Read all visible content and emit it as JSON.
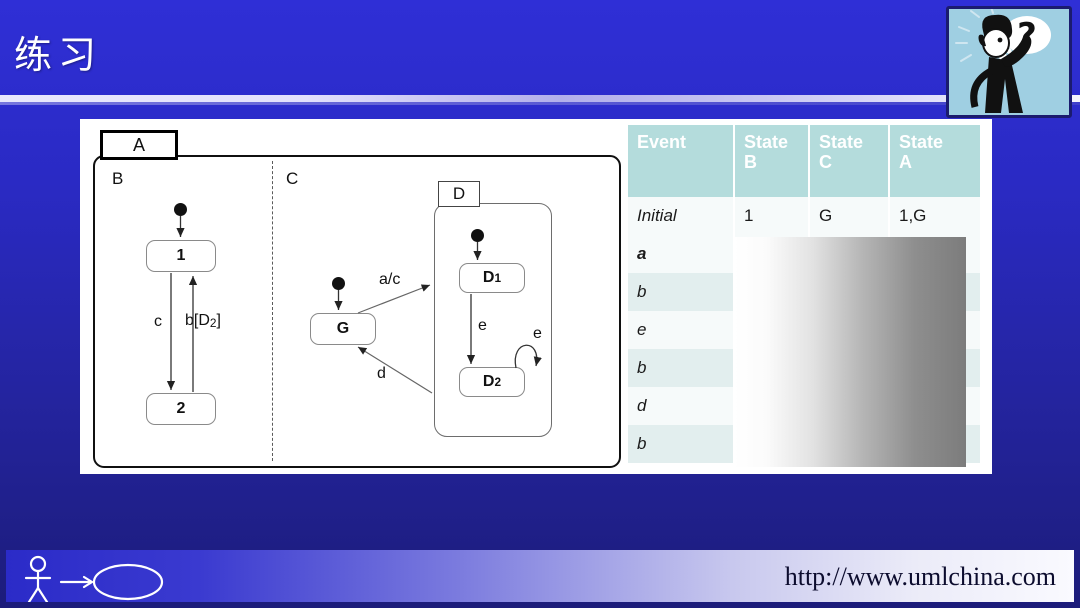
{
  "slide": {
    "title": "练习",
    "background_top": "#2f2fd6",
    "background_bottom": "#1c1c7a"
  },
  "decoration": {
    "thinker_icon": "thinking-person-icon",
    "question_mark": "?"
  },
  "diagram": {
    "outer_state_name": "A",
    "regions": [
      {
        "label": "B"
      },
      {
        "label": "C"
      }
    ],
    "states": [
      {
        "id": "s1",
        "label": "1"
      },
      {
        "id": "s2",
        "label": "2"
      },
      {
        "id": "sG",
        "label": "G"
      },
      {
        "id": "sD1",
        "label": "D",
        "sub": "1"
      },
      {
        "id": "sD2",
        "label": "D",
        "sub": "2"
      }
    ],
    "composite_state_name": "D",
    "transitions": [
      {
        "from": "1",
        "to": "2",
        "label": "c"
      },
      {
        "from": "2",
        "to": "1",
        "label": "b[D2]",
        "label_main": "b[D",
        "label_sub": "2",
        "label_tail": "]"
      },
      {
        "from": "G",
        "to": "D",
        "label": "a/c"
      },
      {
        "from": "D",
        "to": "G",
        "label": "d"
      },
      {
        "from": "D1",
        "to": "D2",
        "label": "e"
      },
      {
        "from": "D2",
        "to": "D2",
        "label": "e"
      }
    ]
  },
  "table": {
    "headers": [
      "Event",
      "State B",
      "State C",
      "State A"
    ],
    "header_lines": [
      [
        "Event",
        ""
      ],
      [
        "State",
        "B"
      ],
      [
        "State",
        "C"
      ],
      [
        "State",
        "A"
      ]
    ],
    "rows": [
      {
        "event": "Initial",
        "emphasis": "italic",
        "b": "1",
        "c": "G",
        "a": "1,G"
      },
      {
        "event": "a",
        "emphasis": "bold-italic",
        "b": "",
        "c": "",
        "a": ""
      },
      {
        "event": "b",
        "emphasis": "italic",
        "b": "",
        "c": "",
        "a": ""
      },
      {
        "event": "e",
        "emphasis": "italic",
        "b": "",
        "c": "",
        "a": ""
      },
      {
        "event": "b",
        "emphasis": "italic",
        "b": "",
        "c": "",
        "a": ""
      },
      {
        "event": "d",
        "emphasis": "italic",
        "b": "",
        "c": "",
        "a": ""
      },
      {
        "event": "b",
        "emphasis": "italic",
        "b": "",
        "c": "",
        "a": ""
      }
    ],
    "header_bg": "#b4dcdc",
    "row_bg_odd": "#f6fafa",
    "row_bg_even": "#e2eeee",
    "answer_mask": "hidden-answers-gradient"
  },
  "footer": {
    "url": "http://www.umlchina.com",
    "actor_icon": "uml-actor-icon",
    "usecase_icon": "uml-usecase-ellipse-icon"
  }
}
